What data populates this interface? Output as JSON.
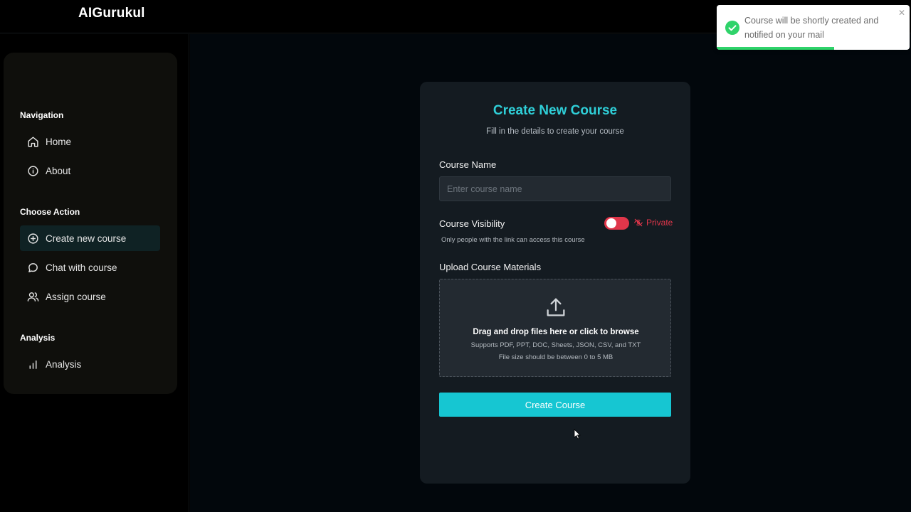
{
  "app": {
    "brand": "AIGurukul"
  },
  "sidebar": {
    "sections": [
      {
        "title": "Navigation",
        "items": [
          {
            "label": "Home",
            "icon": "home-icon"
          },
          {
            "label": "About",
            "icon": "info-icon"
          }
        ]
      },
      {
        "title": "Choose Action",
        "items": [
          {
            "label": "Create new course",
            "icon": "plus-circle-icon",
            "active": true
          },
          {
            "label": "Chat with course",
            "icon": "chat-icon"
          },
          {
            "label": "Assign course",
            "icon": "users-icon"
          }
        ]
      },
      {
        "title": "Analysis",
        "items": [
          {
            "label": "Analysis",
            "icon": "bar-chart-icon"
          }
        ]
      }
    ]
  },
  "form": {
    "title": "Create New Course",
    "subtitle": "Fill in the details to create your course",
    "course_name_label": "Course Name",
    "course_name_placeholder": "Enter course name",
    "course_name_value": "",
    "visibility_label": "Course Visibility",
    "visibility_state": "Private",
    "visibility_helper": "Only people with the link can access this course",
    "upload_label": "Upload Course Materials",
    "dropzone_main": "Drag and drop files here or click to browse",
    "dropzone_formats": "Supports PDF, PPT, DOC, Sheets, JSON, CSV, and TXT",
    "dropzone_size": "File size should be between 0 to 5 MB",
    "submit_label": "Create Course"
  },
  "toast": {
    "message": "Course will be shortly created and notified on your mail",
    "close": "✕",
    "progress_fraction": 0.61,
    "status": "success"
  },
  "colors": {
    "accent": "#16c6d2",
    "title": "#2fcfd8",
    "private": "#e0364a",
    "success": "#2fd36a"
  }
}
